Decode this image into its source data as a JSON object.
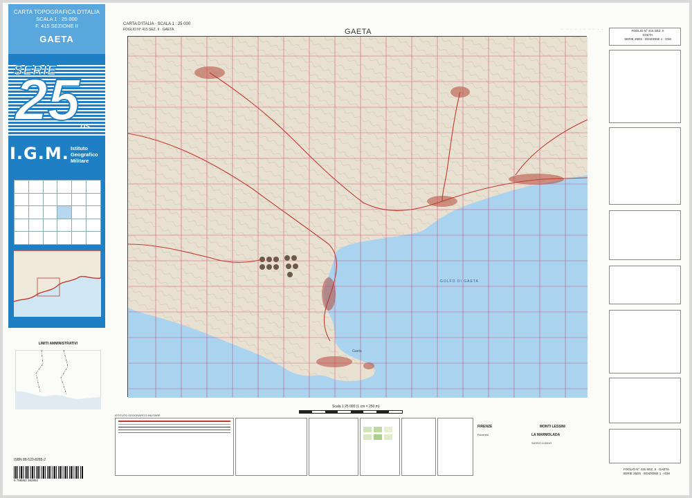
{
  "cover": {
    "line1": "CARTA TOPOGRAFICA D'ITALIA",
    "line2": "SCALA 1 : 25 000",
    "line3": "F. 415 SEZIONE II",
    "sheet_name": "GAETA",
    "series_word": "SERIE",
    "series_number": "25",
    "series_suffix": "DS",
    "logo": "I.G.M.",
    "institute_line1": "Istituto",
    "institute_line2": "Geografico",
    "institute_line3": "Militare"
  },
  "admin": {
    "title": "LIMITI AMMINISTRATIVI"
  },
  "isbn": {
    "text": "ISBN 88-523-8285-2",
    "digits": "9 788852 382852"
  },
  "map": {
    "header_line1": "CARTA D'ITALIA · SCALA 1 : 25 000",
    "header_line2": "FOGLIO N° 415 SEZ. II · GAETA",
    "title": "GAETA",
    "city_label": "Gaeta",
    "scale_label": "Scala 1:25 000  (1 cm = 250 m)",
    "colors": {
      "sea": "#a9d3ee",
      "land": "#e8e1d2",
      "grid": "#d23b6a",
      "road": "#c0392b",
      "built": "#b44a3a"
    }
  },
  "right": {
    "sheet_id_l1": "FOGLIO N° 415 SEZ. II",
    "sheet_id_l2": "GAETA",
    "sheet_id_l3": "SERIE 25DS · EDIZIONE 1 · IGM",
    "bottom_id_l1": "FOGLIO N° 415 SEZ. II · GAETA",
    "bottom_id_l2": "SERIE 25DS · EDIZIONE 1 · IGM"
  },
  "imprint": {
    "l1": "ISTITUTO GEOGRAFICO MILITARE"
  },
  "edition": {
    "city1": "FIRENZE",
    "city2": "MONTI LESSINI",
    "place1": "Rovereto",
    "place2": "LA MARMOLADA",
    "place3": "SASSO LUNGO"
  }
}
